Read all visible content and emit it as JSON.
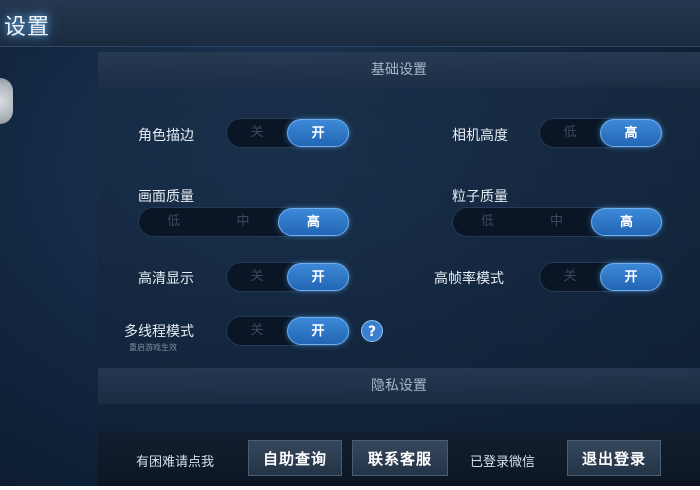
{
  "header": {
    "title": "设置"
  },
  "sections": {
    "basic": "基础设置",
    "privacy": "隐私设置"
  },
  "settings": {
    "outline": {
      "label": "角色描边",
      "options": [
        "关",
        "开"
      ],
      "selected": 1
    },
    "camera": {
      "label": "相机高度",
      "options": [
        "低",
        "高"
      ],
      "selected": 1
    },
    "quality": {
      "label": "画面质量",
      "options": [
        "低",
        "中",
        "高"
      ],
      "selected": 2
    },
    "particle": {
      "label": "粒子质量",
      "options": [
        "低",
        "中",
        "高"
      ],
      "selected": 2
    },
    "hd": {
      "label": "高清显示",
      "options": [
        "关",
        "开"
      ],
      "selected": 1
    },
    "hfr": {
      "label": "高帧率模式",
      "options": [
        "关",
        "开"
      ],
      "selected": 1
    },
    "mt": {
      "label": "多线程模式",
      "sublabel": "重启游戏生效",
      "options": [
        "关",
        "开"
      ],
      "selected": 1
    }
  },
  "help": {
    "icon": "question-icon",
    "glyph": "?"
  },
  "footer": {
    "trouble_text": "有困难请点我",
    "self_help": "自助查询",
    "contact": "联系客服",
    "logged_in": "已登录微信",
    "logout": "退出登录"
  },
  "colors": {
    "accent": "#2f7bd0",
    "background": "#132842"
  }
}
